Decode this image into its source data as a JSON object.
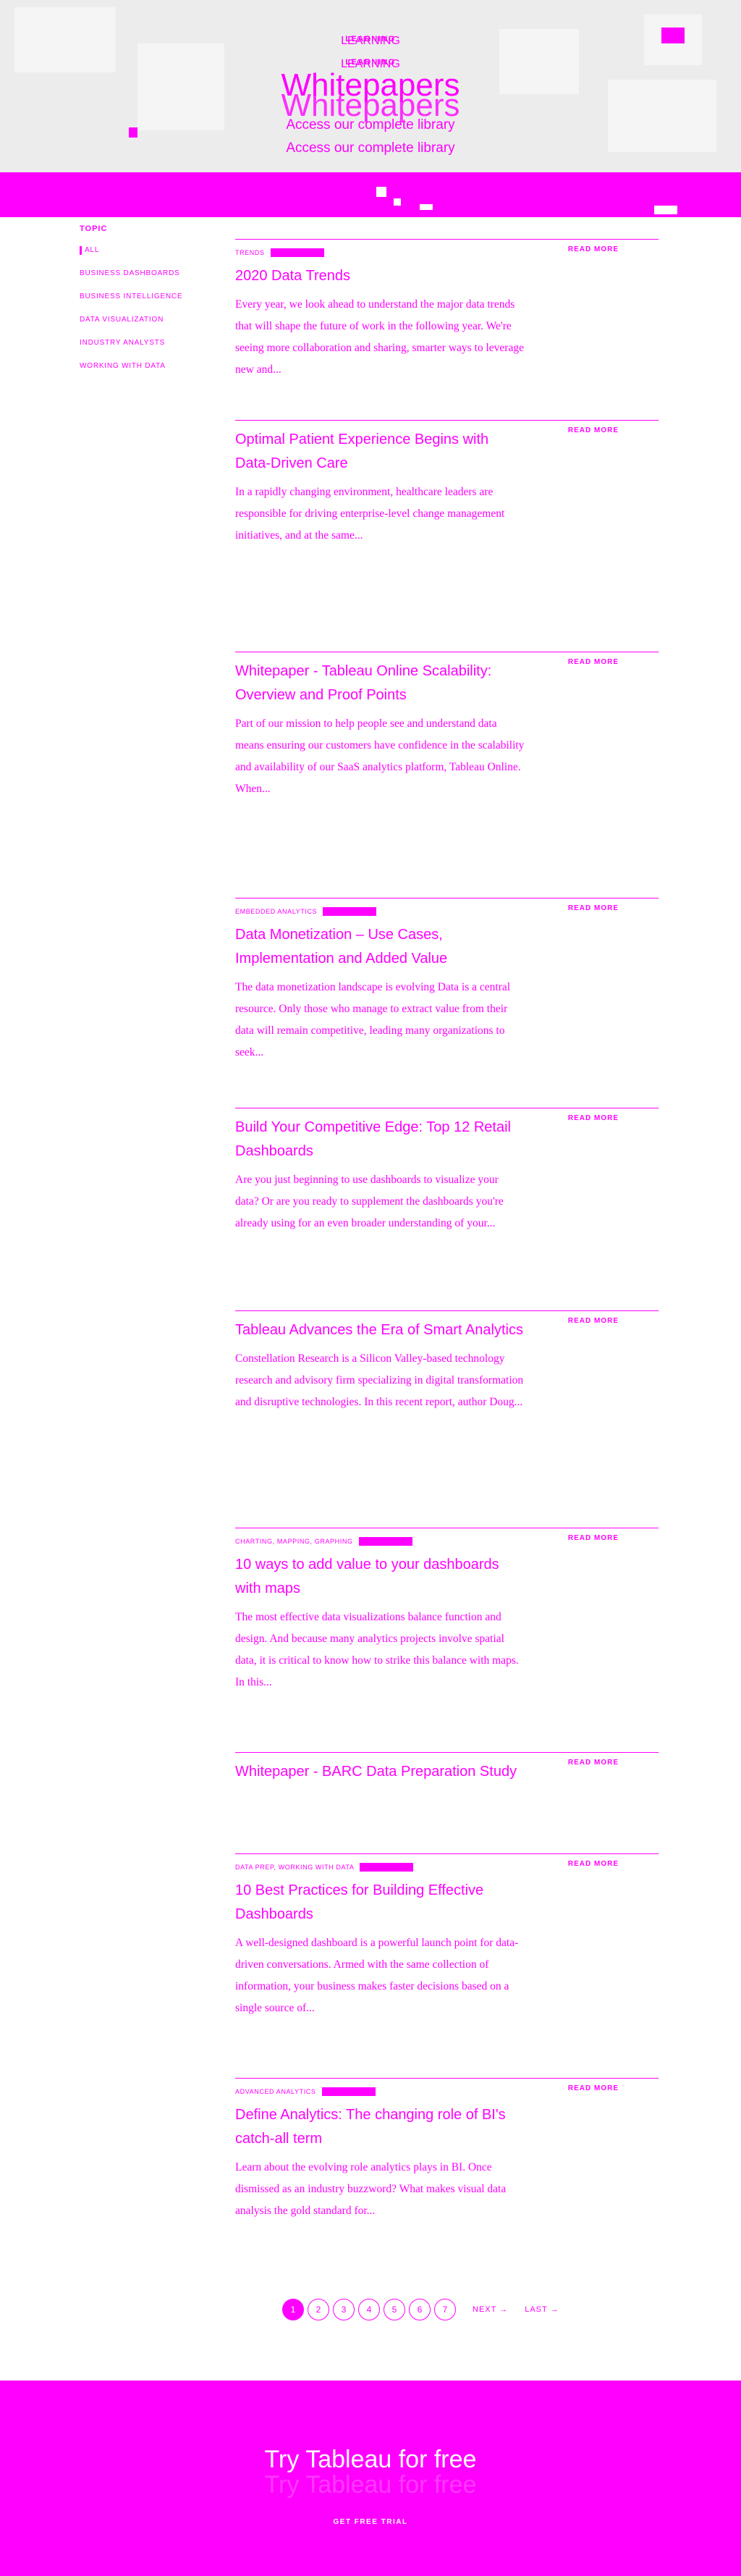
{
  "hero": {
    "eyebrow": "LEARNING",
    "title": "Whitepapers",
    "subtitle": "Access our complete library"
  },
  "sidebar": {
    "heading": "TOPIC",
    "items": [
      {
        "label": "ALL",
        "active": true
      },
      {
        "label": "BUSINESS DASHBOARDS"
      },
      {
        "label": "BUSINESS INTELLIGENCE"
      },
      {
        "label": "DATA VISUALIZATION"
      },
      {
        "label": "INDUSTRY ANALYSTS"
      },
      {
        "label": "WORKING WITH DATA"
      }
    ]
  },
  "read_more": "READ MORE",
  "cards": [
    {
      "tag": "TRENDS",
      "title": "2020 Data Trends",
      "desc": "Every year, we look ahead to understand the major data trends that will shape the future of work in the following year. We're seeing more collaboration and sharing, smarter ways to leverage new and..."
    },
    {
      "tag": "",
      "title": "Optimal Patient Experience Begins with Data-Driven Care",
      "desc": "In a rapidly changing environment, healthcare leaders are responsible for driving enterprise-level change management initiatives, and at the same..."
    },
    {
      "tag": "",
      "title": "Whitepaper - Tableau Online Scalability: Overview and Proof Points",
      "desc": "Part of our mission to help people see and understand data means ensuring our customers have confidence in the scalability and availability of our SaaS analytics platform, Tableau Online. When..."
    },
    {
      "tag": "EMBEDDED ANALYTICS",
      "title": "Data Monetization – Use Cases, Implementation and Added Value",
      "desc": "The data monetization landscape is evolving Data is a central resource. Only those who manage to extract value from their data will remain competitive, leading many organizations to seek..."
    },
    {
      "tag": "",
      "title": "Build Your Competitive Edge: Top 12 Retail Dashboards",
      "desc": "Are you just beginning to use dashboards to visualize your data? Or are you ready to supplement the dashboards you're already using for an even broader understanding of your..."
    },
    {
      "tag": "",
      "title": "Tableau Advances the Era of Smart Analytics",
      "desc": "Constellation Research is a Silicon Valley-based technology research and advisory firm specializing in digital transformation and disruptive technologies. In this recent report, author Doug..."
    },
    {
      "tag": "CHARTING, MAPPING, GRAPHING",
      "title": "10 ways to add value to your dashboards with maps",
      "desc": "The most effective data visualizations balance function and design. And because many analytics projects involve spatial data, it is critical to know how to strike this balance with maps. In this..."
    },
    {
      "tag": "",
      "title": "Whitepaper - BARC Data Preparation Study",
      "desc": ""
    },
    {
      "tag": "DATA PREP, WORKING WITH DATA",
      "title": "10 Best Practices for Building Effective Dashboards",
      "desc": "A well-designed dashboard is a powerful launch point for data-driven conversations. Armed with the same collection of information, your business makes faster decisions based on a single source of..."
    },
    {
      "tag": "ADVANCED ANALYTICS",
      "title": "Define Analytics: The changing role of BI's catch-all term",
      "desc": "Learn about the evolving role analytics plays in BI. Once dismissed as an industry buzzword? What makes visual data analysis the gold standard for..."
    }
  ],
  "pagination": {
    "pages": [
      "1",
      "2",
      "3",
      "4",
      "5",
      "6",
      "7"
    ],
    "next": "NEXT →",
    "last": "LAST →"
  },
  "footer": {
    "headline": "Try Tableau for free",
    "cta": "GET FREE TRIAL"
  }
}
